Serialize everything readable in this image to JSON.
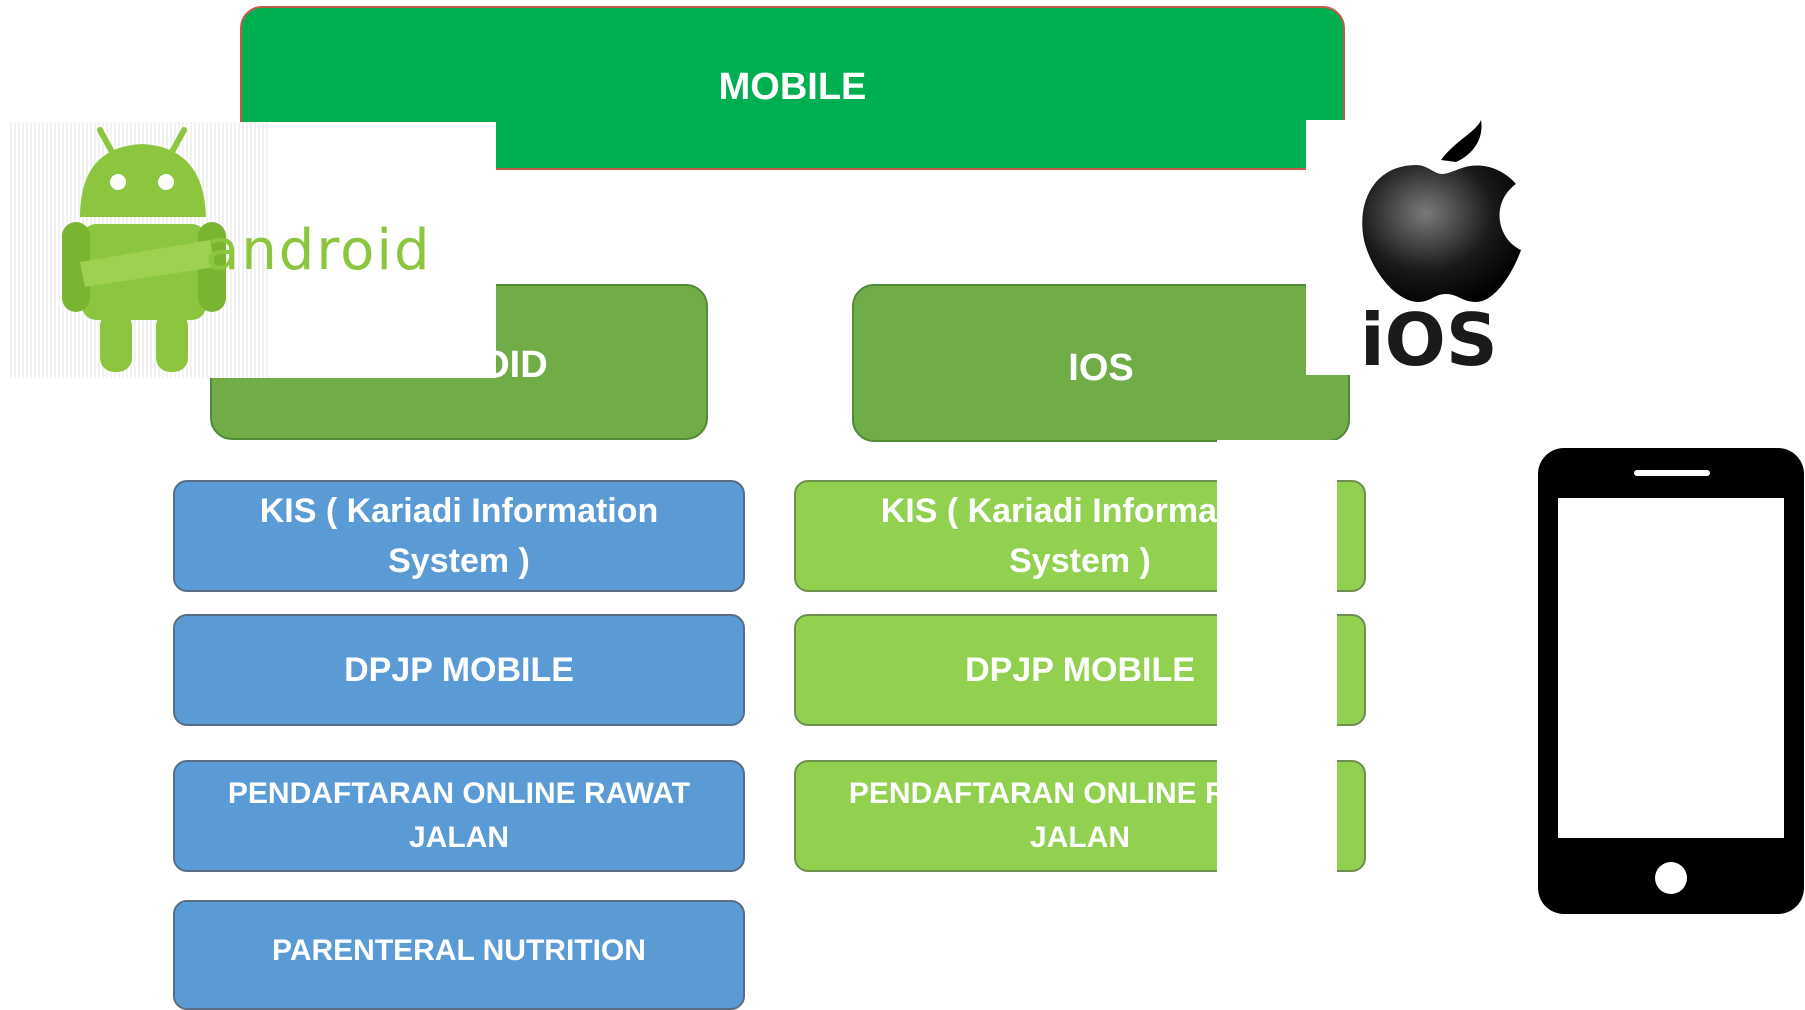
{
  "top": {
    "label": "MOBILE"
  },
  "platforms": {
    "android": {
      "label": "ANDROID",
      "logo_text": "android"
    },
    "ios": {
      "label": "IOS",
      "logo_text": "iOS"
    }
  },
  "android_apps": [
    {
      "label": "KIS ( Kariadi Information System )"
    },
    {
      "label": "DPJP MOBILE"
    },
    {
      "label": "PENDAFTARAN ONLINE RAWAT JALAN"
    },
    {
      "label": "PARENTERAL NUTRITION"
    }
  ],
  "ios_apps": [
    {
      "label": "KIS ( Kariadi Information System )"
    },
    {
      "label": "DPJP MOBILE"
    },
    {
      "label": "PENDAFTARAN ONLINE RAWAT JALAN"
    }
  ],
  "colors": {
    "top_fill": "#00b050",
    "platform_fill": "#70ad47",
    "android_item_fill": "#5b9bd5",
    "ios_item_fill": "#92d050"
  },
  "icons": [
    "android-robot-icon",
    "apple-icon",
    "smartphone-icon"
  ]
}
